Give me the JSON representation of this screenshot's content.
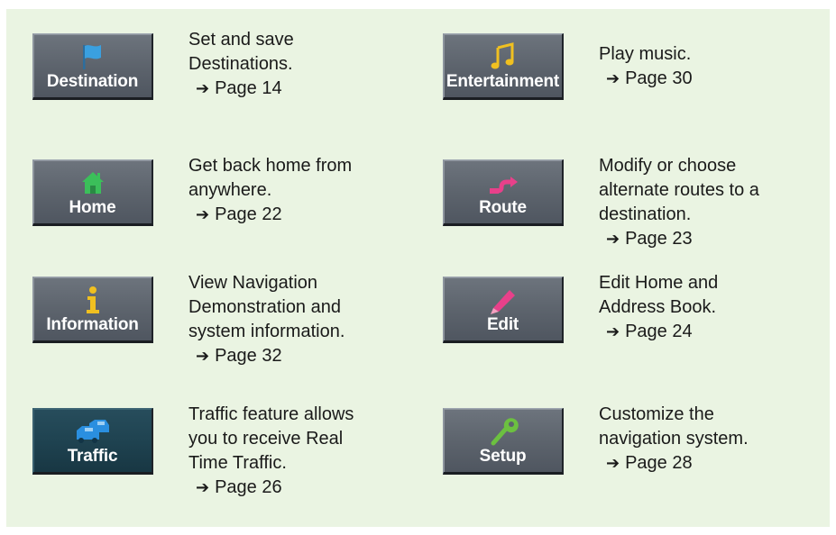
{
  "items": [
    {
      "label": "Destination",
      "icon": "flag-icon",
      "description": [
        "Set and save",
        "Destinations."
      ],
      "page_ref": "Page 14"
    },
    {
      "label": "Entertainment",
      "icon": "music-note-icon",
      "description": [
        "Play music."
      ],
      "page_ref": "Page 30"
    },
    {
      "label": "Home",
      "icon": "house-icon",
      "description": [
        "Get back home from",
        "anywhere."
      ],
      "page_ref": "Page 22"
    },
    {
      "label": "Route",
      "icon": "route-icon",
      "description": [
        "Modify or choose",
        "alternate routes to a",
        "destination."
      ],
      "page_ref": "Page 23"
    },
    {
      "label": "Information",
      "icon": "info-icon",
      "description": [
        "View Navigation",
        "Demonstration and",
        "system information."
      ],
      "page_ref": "Page 32"
    },
    {
      "label": "Edit",
      "icon": "pencil-icon",
      "description": [
        "Edit Home and",
        "Address Book."
      ],
      "page_ref": "Page 24"
    },
    {
      "label": "Traffic",
      "icon": "traffic-cars-icon",
      "description": [
        "Traffic feature allows",
        "you to receive Real",
        "Time Traffic."
      ],
      "page_ref": "Page 26"
    },
    {
      "label": "Setup",
      "icon": "wrench-icon",
      "description": [
        "Customize the",
        "navigation system."
      ],
      "page_ref": "Page 28"
    }
  ],
  "arrow_symbol": "➔",
  "colors": {
    "background": "#eaf4e2",
    "button": "#5d646d",
    "button_active": "#1f4351",
    "flag": "#3aa0e0",
    "music": "#f0c020",
    "house": "#3bbf5a",
    "route": "#e8408a",
    "info": "#f0c020",
    "pencil": "#e8408a",
    "traffic": "#2a8fe0",
    "wrench": "#6cc040"
  }
}
